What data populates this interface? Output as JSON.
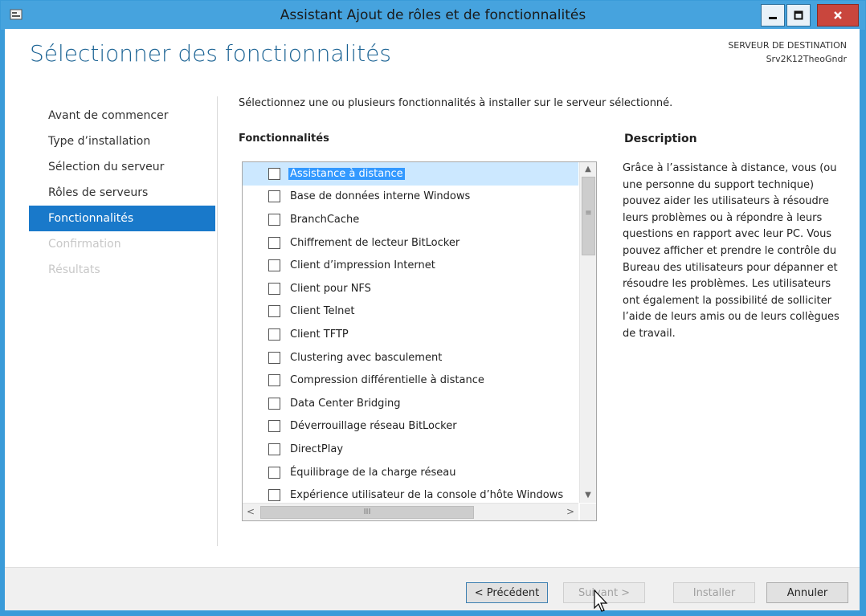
{
  "window": {
    "title": "Assistant Ajout de rôles et de fonctionnalités",
    "controls": {
      "minimize": "minimize-icon",
      "maximize": "maximize-icon",
      "close": "close-icon"
    }
  },
  "header": {
    "page_title": "Sélectionner des fonctionnalités",
    "destination_label": "SERVEUR DE DESTINATION",
    "destination_server": "Srv2K12TheoGndr"
  },
  "nav": {
    "items": [
      {
        "label": "Avant de commencer",
        "state": "normal"
      },
      {
        "label": "Type d’installation",
        "state": "normal"
      },
      {
        "label": "Sélection du serveur",
        "state": "normal"
      },
      {
        "label": "Rôles de serveurs",
        "state": "normal"
      },
      {
        "label": "Fonctionnalités",
        "state": "active"
      },
      {
        "label": "Confirmation",
        "state": "disabled"
      },
      {
        "label": "Résultats",
        "state": "disabled"
      }
    ]
  },
  "main": {
    "intro": "Sélectionnez une ou plusieurs fonctionnalités à installer sur le serveur sélectionné.",
    "features_heading": "Fonctionnalités",
    "description_heading": "Description",
    "description": "Grâce à l’assistance à distance, vous (ou une personne du support technique) pouvez aider les utilisateurs à résoudre leurs problèmes ou à répondre à leurs questions en rapport avec leur PC. Vous pouvez afficher et prendre le contrôle du Bureau des utilisateurs pour dépanner et résoudre les problèmes. Les utilisateurs ont également la possibilité de solliciter l’aide de leurs amis ou de leurs collègues de travail.",
    "features": [
      {
        "label": "Assistance à distance",
        "checked": false,
        "selected": true
      },
      {
        "label": "Base de données interne Windows",
        "checked": false
      },
      {
        "label": "BranchCache",
        "checked": false
      },
      {
        "label": "Chiffrement de lecteur BitLocker",
        "checked": false
      },
      {
        "label": "Client d’impression Internet",
        "checked": false
      },
      {
        "label": "Client pour NFS",
        "checked": false
      },
      {
        "label": "Client Telnet",
        "checked": false
      },
      {
        "label": "Client TFTP",
        "checked": false
      },
      {
        "label": "Clustering avec basculement",
        "checked": false
      },
      {
        "label": "Compression différentielle à distance",
        "checked": false
      },
      {
        "label": "Data Center Bridging",
        "checked": false
      },
      {
        "label": "Déverrouillage réseau BitLocker",
        "checked": false
      },
      {
        "label": "DirectPlay",
        "checked": false
      },
      {
        "label": "Équilibrage de la charge réseau",
        "checked": false
      },
      {
        "label": "Expérience utilisateur de la console d’hôte Windows",
        "checked": false
      }
    ],
    "scrollbar": {
      "up": "▲",
      "down": "▼",
      "left": "<",
      "right": ">",
      "grip_v": "≡",
      "grip_h": "III"
    }
  },
  "footer": {
    "previous": "< Précédent",
    "next": "Suivant >",
    "install": "Installer",
    "cancel": "Annuler"
  },
  "colors": {
    "title_bar": "#46a3de",
    "accent": "#1979ca",
    "page_title": "#1b6394",
    "close": "#c9463d"
  }
}
